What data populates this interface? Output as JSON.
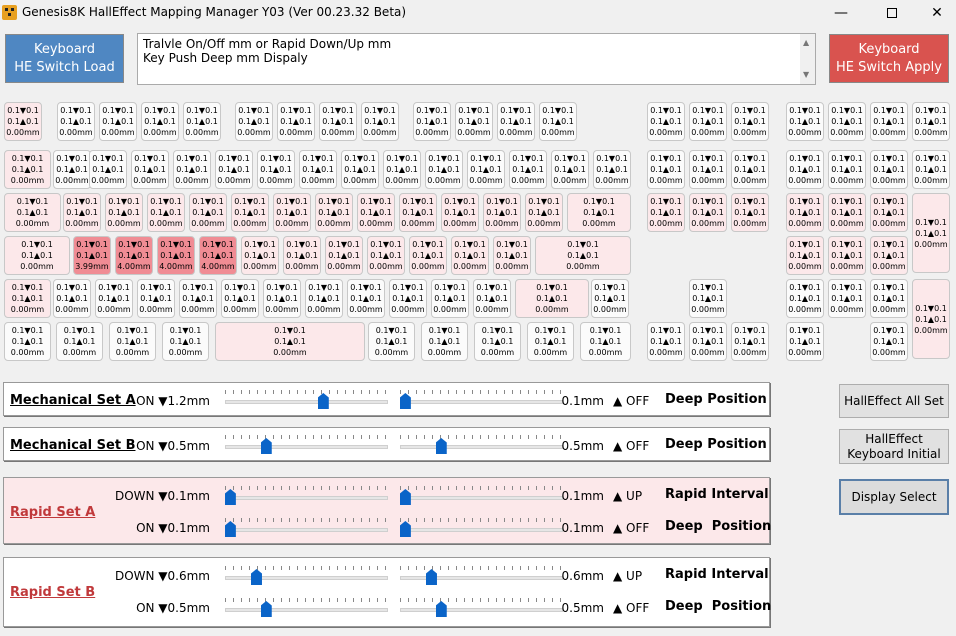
{
  "window": {
    "title": "Genesis8K HallEffect Mapping Manager Y03 (Ver 00.23.32 Beta)",
    "minimize_icon": "minimize-icon",
    "maximize_icon": "maximize-icon",
    "close_icon": "close-icon"
  },
  "load_button": {
    "line1": "Keyboard",
    "line2": "HE Switch Load"
  },
  "apply_button": {
    "line1": "Keyboard",
    "line2": "HE Switch Apply"
  },
  "info_box": {
    "line1": "Tralvle On/Off mm or Rapid Down/Up mm",
    "line2": "Key Push Deep mm Dispaly"
  },
  "key_default": {
    "on": "0.1▼0.1",
    "rapid": "0.1▲0.1",
    "deep": "0.00mm"
  },
  "key_hot": {
    "on": "0.1▼0.1",
    "rapid": "0.1▲0.1",
    "deep": "4.00mm"
  },
  "key_hot_first_deep": "3.99mm",
  "hot_colors": {
    "pink": "#fce8ea",
    "highlight": "#f08c94"
  },
  "mech_a": {
    "title": "Mechanical Set A",
    "left_label": "ON ▼1.2mm",
    "left_value": 0.6,
    "right_label": "0.1mm",
    "right_value": 0.03,
    "right_state": "▲ OFF",
    "right_title": "Deep Position"
  },
  "mech_b": {
    "title": "Mechanical Set B",
    "left_label": "ON ▼0.5mm",
    "left_value": 0.25,
    "right_label": "0.5mm",
    "right_value": 0.25,
    "right_state": "▲ OFF",
    "right_title": "Deep Position"
  },
  "rapid_a": {
    "title": "Rapid Set A",
    "row1_left": "DOWN ▼0.1mm",
    "row1_left_value": 0.03,
    "row1_right": "0.1mm",
    "row1_right_value": 0.03,
    "row1_state": "▲ UP",
    "row1_title": "Rapid Interval",
    "row2_left": "ON ▼0.1mm",
    "row2_left_value": 0.03,
    "row2_right": "0.1mm",
    "row2_right_value": 0.03,
    "row2_state": "▲ OFF",
    "row2_title": "Deep  Position"
  },
  "rapid_b": {
    "title": "Rapid Set B",
    "row1_left": "DOWN ▼0.6mm",
    "row1_left_value": 0.19,
    "row1_right": "0.6mm",
    "row1_right_value": 0.19,
    "row1_state": "▲ UP",
    "row1_title": "Rapid Interval",
    "row2_left": "ON ▼0.5mm",
    "row2_left_value": 0.25,
    "row2_right": "0.5mm",
    "row2_right_value": 0.25,
    "row2_state": "▲ OFF",
    "row2_title": "Deep  Position"
  },
  "side_buttons": {
    "all_set": "HallEffect All Set",
    "initial_line1": "HallEffect",
    "initial_line2": "Keyboard Initial",
    "display_select": "Display Select"
  }
}
